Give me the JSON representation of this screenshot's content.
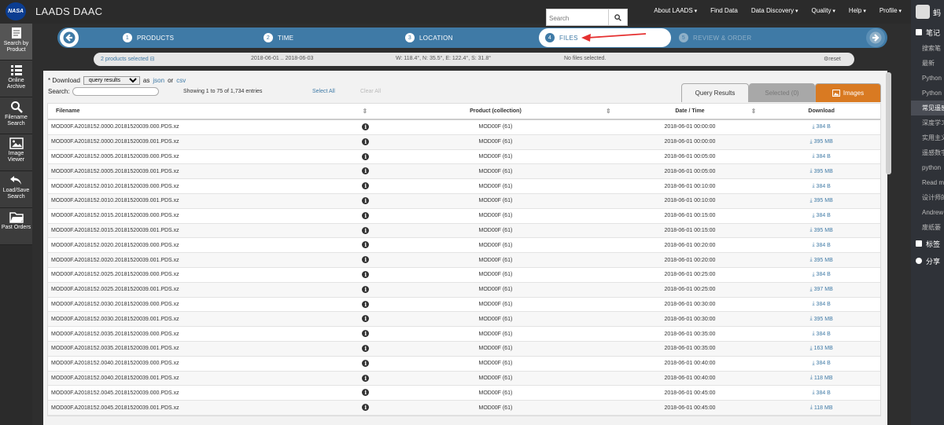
{
  "app": {
    "logo_text": "NASA",
    "title": "LAADS DAAC"
  },
  "topnav": {
    "search_placeholder": "Search",
    "items": [
      "About LAADS",
      "Find Data",
      "Data Discovery",
      "Quality",
      "Help",
      "Profile"
    ]
  },
  "leftbar": {
    "items": [
      {
        "label": "Search by Product",
        "icon": "document-icon"
      },
      {
        "label": "Online Archive",
        "icon": "list-icon"
      },
      {
        "label": "Filename Search",
        "icon": "search-icon"
      },
      {
        "label": "Image Viewer",
        "icon": "image-icon"
      },
      {
        "label": "Load/Save Search",
        "icon": "undo-icon"
      },
      {
        "label": "Past Orders",
        "icon": "folder-icon"
      }
    ]
  },
  "wizard": {
    "steps": [
      {
        "num": "1",
        "label": "PRODUCTS"
      },
      {
        "num": "2",
        "label": "TIME"
      },
      {
        "num": "3",
        "label": "LOCATION"
      },
      {
        "num": "4",
        "label": "FILES"
      },
      {
        "num": "5",
        "label": "REVIEW & ORDER"
      }
    ]
  },
  "summary": {
    "products": "2 products selected",
    "dates": "2018-06-01 .. 2018-06-03",
    "location": "W: 118.4°, N: 35.5°, E: 122.4°, S: 31.8°",
    "files": "No files selected.",
    "reset": "reset"
  },
  "controls": {
    "download_label": "* Download",
    "download_option": "query results",
    "as_label": "as",
    "json_link": "json",
    "or_label": "or",
    "csv_link": "csv",
    "search_label": "Search:",
    "entries_text": "Showing 1 to 75 of 1,734 entries",
    "select_all": "Select All",
    "clear_all": "Clear All"
  },
  "tabs": {
    "query_results": "Query Results",
    "selected": "Selected (0)",
    "images": "Images"
  },
  "table": {
    "columns": [
      "Filename",
      "Product (collection)",
      "Date / Time",
      "Download"
    ],
    "rows": [
      {
        "file": "MOD00F.A2018152.0000.20181520039.000.PDS.xz",
        "product": "MOD00F (61)",
        "time": "2018-06-01 00:00:00",
        "size": "384 B"
      },
      {
        "file": "MOD00F.A2018152.0000.20181520039.001.PDS.xz",
        "product": "MOD00F (61)",
        "time": "2018-06-01 00:00:00",
        "size": "395 MB"
      },
      {
        "file": "MOD00F.A2018152.0005.20181520039.000.PDS.xz",
        "product": "MOD00F (61)",
        "time": "2018-06-01 00:05:00",
        "size": "384 B"
      },
      {
        "file": "MOD00F.A2018152.0005.20181520039.001.PDS.xz",
        "product": "MOD00F (61)",
        "time": "2018-06-01 00:05:00",
        "size": "395 MB"
      },
      {
        "file": "MOD00F.A2018152.0010.20181520039.000.PDS.xz",
        "product": "MOD00F (61)",
        "time": "2018-06-01 00:10:00",
        "size": "384 B"
      },
      {
        "file": "MOD00F.A2018152.0010.20181520039.001.PDS.xz",
        "product": "MOD00F (61)",
        "time": "2018-06-01 00:10:00",
        "size": "395 MB"
      },
      {
        "file": "MOD00F.A2018152.0015.20181520039.000.PDS.xz",
        "product": "MOD00F (61)",
        "time": "2018-06-01 00:15:00",
        "size": "384 B"
      },
      {
        "file": "MOD00F.A2018152.0015.20181520039.001.PDS.xz",
        "product": "MOD00F (61)",
        "time": "2018-06-01 00:15:00",
        "size": "395 MB"
      },
      {
        "file": "MOD00F.A2018152.0020.20181520039.000.PDS.xz",
        "product": "MOD00F (61)",
        "time": "2018-06-01 00:20:00",
        "size": "384 B"
      },
      {
        "file": "MOD00F.A2018152.0020.20181520039.001.PDS.xz",
        "product": "MOD00F (61)",
        "time": "2018-06-01 00:20:00",
        "size": "395 MB"
      },
      {
        "file": "MOD00F.A2018152.0025.20181520039.000.PDS.xz",
        "product": "MOD00F (61)",
        "time": "2018-06-01 00:25:00",
        "size": "384 B"
      },
      {
        "file": "MOD00F.A2018152.0025.20181520039.001.PDS.xz",
        "product": "MOD00F (61)",
        "time": "2018-06-01 00:25:00",
        "size": "397 MB"
      },
      {
        "file": "MOD00F.A2018152.0030.20181520039.000.PDS.xz",
        "product": "MOD00F (61)",
        "time": "2018-06-01 00:30:00",
        "size": "384 B"
      },
      {
        "file": "MOD00F.A2018152.0030.20181520039.001.PDS.xz",
        "product": "MOD00F (61)",
        "time": "2018-06-01 00:30:00",
        "size": "395 MB"
      },
      {
        "file": "MOD00F.A2018152.0035.20181520039.000.PDS.xz",
        "product": "MOD00F (61)",
        "time": "2018-06-01 00:35:00",
        "size": "384 B"
      },
      {
        "file": "MOD00F.A2018152.0035.20181520039.001.PDS.xz",
        "product": "MOD00F (61)",
        "time": "2018-06-01 00:35:00",
        "size": "163 MB"
      },
      {
        "file": "MOD00F.A2018152.0040.20181520039.000.PDS.xz",
        "product": "MOD00F (61)",
        "time": "2018-06-01 00:40:00",
        "size": "384 B"
      },
      {
        "file": "MOD00F.A2018152.0040.20181520039.001.PDS.xz",
        "product": "MOD00F (61)",
        "time": "2018-06-01 00:40:00",
        "size": "118 MB"
      },
      {
        "file": "MOD00F.A2018152.0045.20181520039.000.PDS.xz",
        "product": "MOD00F (61)",
        "time": "2018-06-01 00:45:00",
        "size": "384 B"
      },
      {
        "file": "MOD00F.A2018152.0045.20181520039.001.PDS.xz",
        "product": "MOD00F (61)",
        "time": "2018-06-01 00:45:00",
        "size": "118 MB"
      }
    ]
  },
  "rightbar": {
    "top_label": "蚂",
    "notes_label": "笔记",
    "items": [
      "搜索笔",
      "最新",
      "Python",
      "Python",
      "常见遥感",
      "深度学习",
      "实用主义",
      "遥感数字",
      "python",
      "Read m",
      "设计师的",
      "Andrew",
      "废纸篓"
    ],
    "selected_index": 4,
    "tags_label": "标签",
    "share_label": "分享"
  },
  "colors": {
    "wizard": "#3f7aa6",
    "images_tab": "#d97a22",
    "link": "#3f7aa6"
  }
}
